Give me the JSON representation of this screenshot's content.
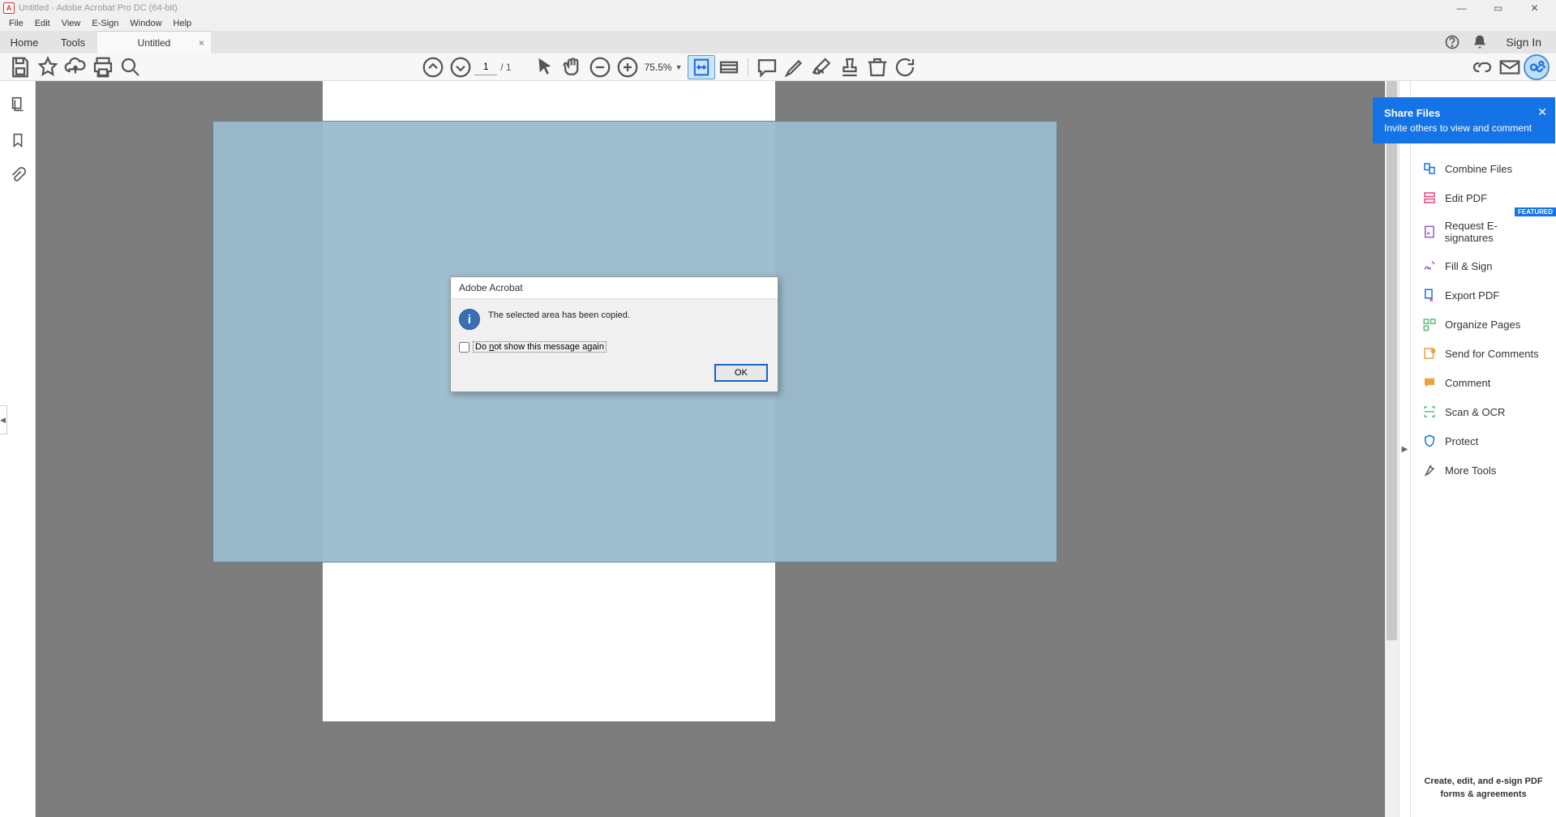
{
  "titlebar": {
    "title": "Untitled - Adobe Acrobat Pro DC (64-bit)"
  },
  "menu": {
    "items": [
      "File",
      "Edit",
      "View",
      "E-Sign",
      "Window",
      "Help"
    ]
  },
  "tabs": {
    "home": "Home",
    "tools": "Tools",
    "doc": "Untitled"
  },
  "header_right": {
    "sign_in": "Sign In"
  },
  "toolbar": {
    "page_current": "1",
    "page_total": "/ 1",
    "zoom": "75.5%"
  },
  "share_tooltip": {
    "title": "Share Files",
    "body": "Invite others to view and comment"
  },
  "right_tools": {
    "items": [
      {
        "label": "Combine Files",
        "color": "#1473e6"
      },
      {
        "label": "Edit PDF",
        "color": "#e8467c"
      },
      {
        "label": "Request E-signatures",
        "color": "#9256d9",
        "badge": "FEATURED"
      },
      {
        "label": "Fill & Sign",
        "color": "#9256d9"
      },
      {
        "label": "Export PDF",
        "color": "#1473e6"
      },
      {
        "label": "Organize Pages",
        "color": "#5eba7d"
      },
      {
        "label": "Send for Comments",
        "color": "#e8a33d"
      },
      {
        "label": "Comment",
        "color": "#e8a33d"
      },
      {
        "label": "Scan & OCR",
        "color": "#5eba7d"
      },
      {
        "label": "Protect",
        "color": "#1473e6"
      },
      {
        "label": "More Tools",
        "color": "#555"
      }
    ],
    "footer": "Create, edit, and e-sign PDF forms & agreements"
  },
  "dialog": {
    "title": "Adobe Acrobat",
    "message": "The selected area has been copied.",
    "checkbox_pre": "Do ",
    "checkbox_u": "n",
    "checkbox_post": "ot show this message again",
    "ok": "OK"
  }
}
